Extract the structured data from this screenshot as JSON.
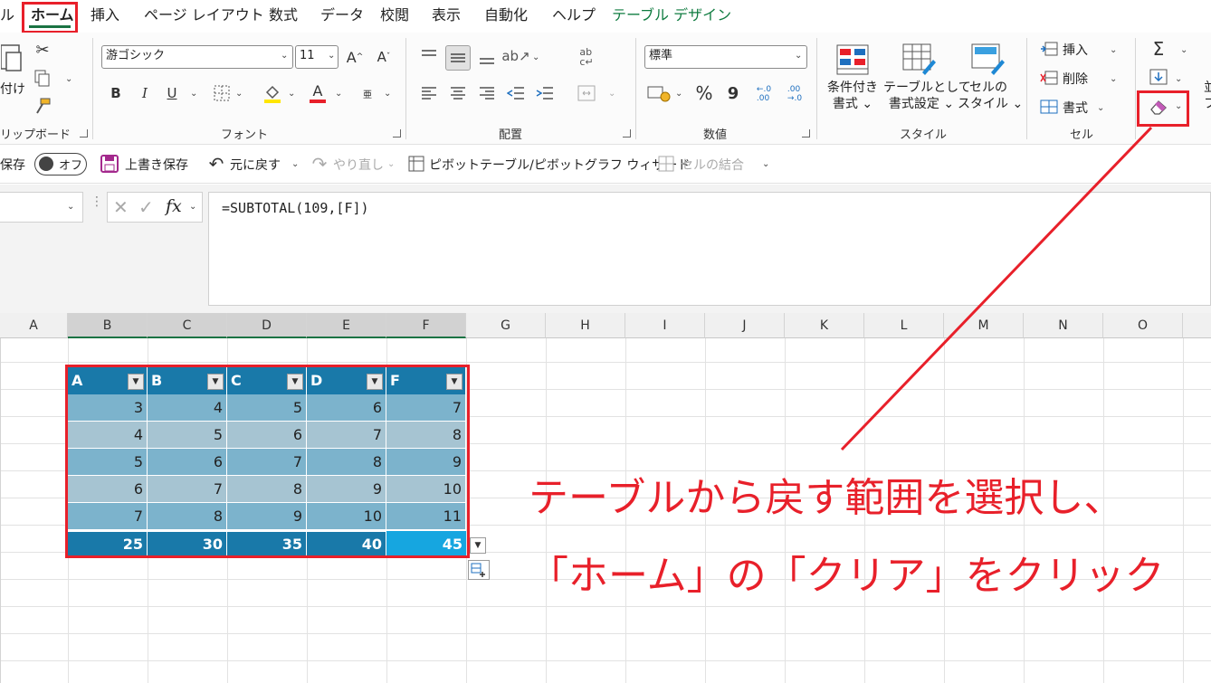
{
  "menu": {
    "tabs": [
      "ル",
      "ホーム",
      "挿入",
      "ページ レイアウト",
      "数式",
      "データ",
      "校閲",
      "表示",
      "自動化",
      "ヘルプ",
      "テーブル デザイン"
    ],
    "active_tab": "ホーム"
  },
  "ribbon": {
    "clipboard": {
      "paste_label": "付け",
      "group_label": "リップボード"
    },
    "font": {
      "font_name": "游ゴシック",
      "font_size": "11",
      "group_label": "フォント",
      "bold": "B",
      "italic": "I",
      "underline": "U",
      "grow": "A^",
      "shrink": "Aˇ",
      "color_letter": "A",
      "phonetic": "亜"
    },
    "alignment": {
      "group_label": "配置"
    },
    "number": {
      "format": "標準",
      "group_label": "数値",
      "percent": "%",
      "comma": "9",
      "inc_decimal": "←.0\n.00",
      "dec_decimal": ".00\n→.0"
    },
    "styles": {
      "conditional": [
        "条件付き",
        "書式"
      ],
      "table_format": [
        "テーブルとして",
        "書式設定"
      ],
      "cell_styles": [
        "セルの",
        "スタイル"
      ],
      "group_label": "スタイル"
    },
    "cells": {
      "insert": "挿入",
      "delete": "削除",
      "format": "書式",
      "group_label": "セル"
    },
    "editing": {
      "sum": "Σ",
      "edge_text": [
        "並",
        "フ"
      ]
    }
  },
  "qat": {
    "autosave": "保存",
    "toggle": "オフ",
    "save": "上書き保存",
    "undo": "元に戻す",
    "redo": "やり直し",
    "pivot": "ピボットテーブル/ピボットグラフ ウィザード",
    "merge": "セルの結合"
  },
  "formula_bar": {
    "fx": "fx",
    "formula": "=SUBTOTAL(109,[F])"
  },
  "columns": [
    "A",
    "B",
    "C",
    "D",
    "E",
    "F",
    "G",
    "H",
    "I",
    "J",
    "K",
    "L",
    "M",
    "N",
    "O"
  ],
  "table": {
    "headers": [
      "A",
      "B",
      "C",
      "D",
      "F"
    ],
    "rows": [
      [
        "3",
        "4",
        "5",
        "6",
        "7"
      ],
      [
        "4",
        "5",
        "6",
        "7",
        "8"
      ],
      [
        "5",
        "6",
        "7",
        "8",
        "9"
      ],
      [
        "6",
        "7",
        "8",
        "9",
        "10"
      ],
      [
        "7",
        "8",
        "9",
        "10",
        "11"
      ]
    ],
    "totals": [
      "25",
      "30",
      "35",
      "40",
      "45"
    ]
  },
  "annotation": {
    "line1": "テーブルから戻す範囲を選択し、",
    "line2": "「ホーム」の「クリア」をクリック"
  },
  "colors": {
    "accent_red": "#e8202a",
    "table_header": "#1979a9",
    "table_band_dark": "#7cb3cc",
    "table_band_light": "#a6c4d2",
    "table_total": "#1979a9",
    "active_cell": "#16a6e0",
    "excel_green": "#1a7343"
  }
}
